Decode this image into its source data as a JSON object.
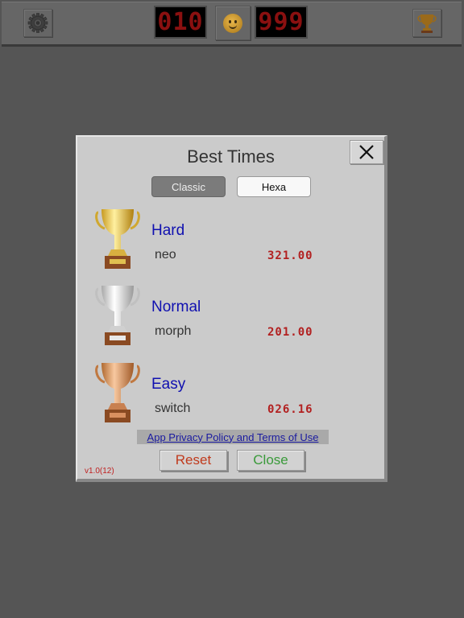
{
  "toolbar": {
    "settings_icon": "gear-icon",
    "mine_counter": "010",
    "face_icon": "smiley-face-icon",
    "timer_counter": "999",
    "best_times_icon": "trophy-icon"
  },
  "dialog": {
    "title": "Best Times",
    "close_icon": "close-x-icon",
    "tabs": [
      {
        "label": "Classic",
        "selected": true
      },
      {
        "label": "Hexa",
        "selected": false
      }
    ],
    "records": [
      {
        "level": "Hard",
        "player": "neo",
        "time": "321.00",
        "trophy": "gold-trophy-icon",
        "color": "#e6c040"
      },
      {
        "level": "Normal",
        "player": "morph",
        "time": "201.00",
        "trophy": "silver-trophy-icon",
        "color": "#d8d8d8"
      },
      {
        "level": "Easy",
        "player": "switch",
        "time": "026.16",
        "trophy": "bronze-trophy-icon",
        "color": "#d08850"
      }
    ],
    "privacy_link": "App Privacy Policy and Terms of Use",
    "reset_label": "Reset",
    "close_label": "Close",
    "version": "v1.0(12)"
  },
  "colors": {
    "level_text": "#1010b0",
    "time_text": "#b22020",
    "reset_text": "#c03a1c",
    "close_text": "#3a9a3a"
  }
}
